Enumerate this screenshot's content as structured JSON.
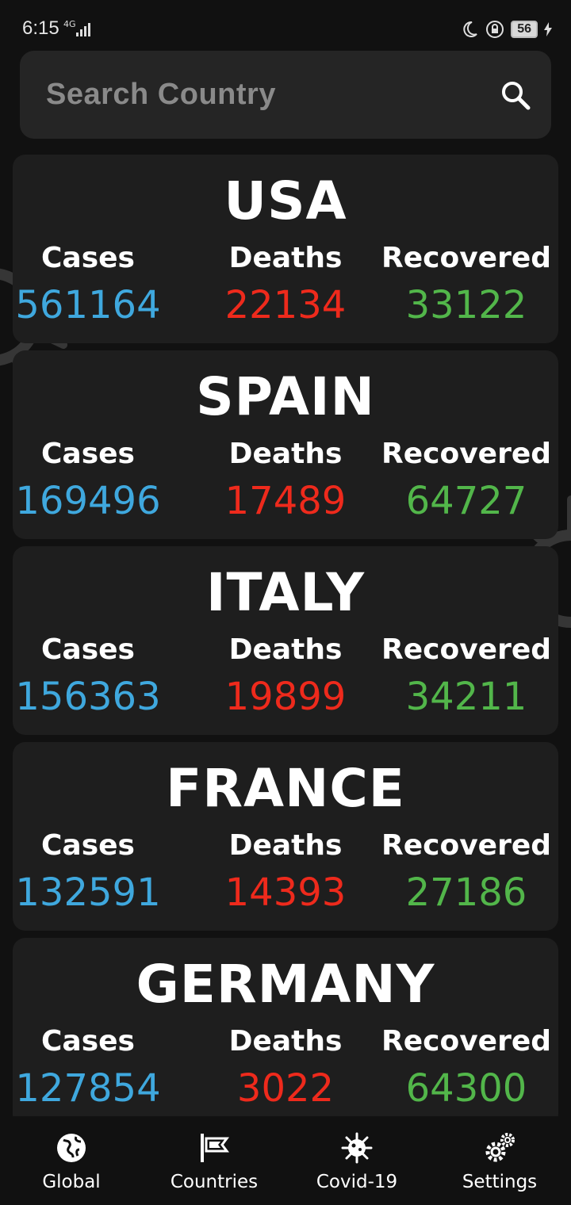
{
  "status": {
    "time": "6:15",
    "network": "4G",
    "battery": "56"
  },
  "search": {
    "placeholder": "Search Country"
  },
  "labels": {
    "cases": "Cases",
    "deaths": "Deaths",
    "recovered": "Recovered"
  },
  "countries": [
    {
      "name": "USA",
      "cases": "561164",
      "deaths": "22134",
      "recovered": "33122"
    },
    {
      "name": "SPAIN",
      "cases": "169496",
      "deaths": "17489",
      "recovered": "64727"
    },
    {
      "name": "ITALY",
      "cases": "156363",
      "deaths": "19899",
      "recovered": "34211"
    },
    {
      "name": "FRANCE",
      "cases": "132591",
      "deaths": "14393",
      "recovered": "27186"
    },
    {
      "name": "GERMANY",
      "cases": "127854",
      "deaths": "3022",
      "recovered": "64300"
    }
  ],
  "nav": [
    {
      "label": "Global",
      "icon": "globe-icon"
    },
    {
      "label": "Countries",
      "icon": "flag-icon"
    },
    {
      "label": "Covid-19",
      "icon": "virus-icon"
    },
    {
      "label": "Settings",
      "icon": "gears-icon"
    }
  ],
  "colors": {
    "cases": "#3fa8de",
    "deaths": "#ee2a1c",
    "recovered": "#52b64a",
    "card": "#1e1e1e"
  }
}
